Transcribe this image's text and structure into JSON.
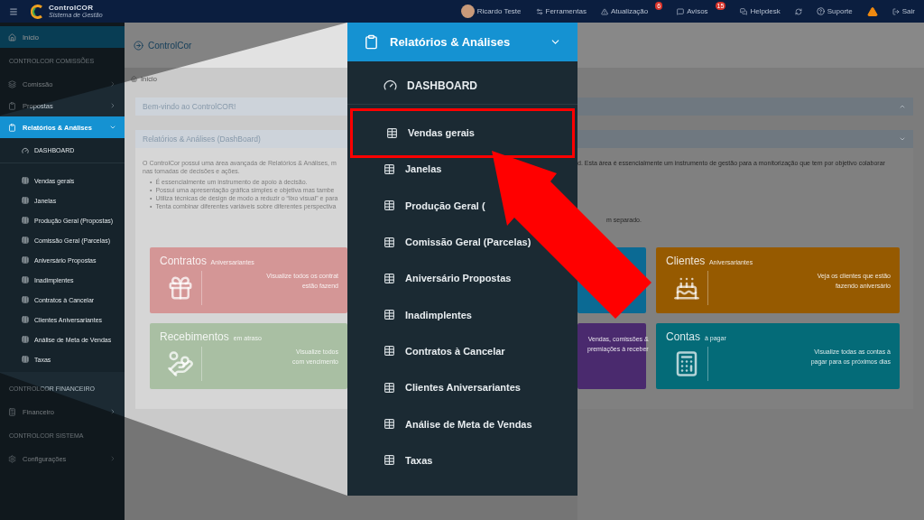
{
  "top_bar": {
    "logo_title": "ControlCOR",
    "logo_subtitle": "Sistema de Gestão",
    "actions": [
      {
        "kind": "user",
        "label": "Ricardo Teste"
      },
      {
        "kind": "link",
        "label": "Ferramentas"
      },
      {
        "kind": "link",
        "label": "Atualização",
        "badge": "6"
      },
      {
        "kind": "link",
        "label": "Avisos",
        "badge": "15"
      },
      {
        "kind": "link",
        "label": "Helpdesk"
      },
      {
        "kind": "icon"
      },
      {
        "kind": "link",
        "label": "Suporte"
      },
      {
        "kind": "icon"
      },
      {
        "kind": "link",
        "label": "Sair"
      }
    ]
  },
  "sidebar": {
    "items": [
      {
        "kind": "link",
        "label": "Início",
        "selected": true
      },
      {
        "kind": "section",
        "label": "CONTROLCOR COMISSÕES"
      },
      {
        "kind": "link",
        "label": "Comissão",
        "selected": false,
        "expanded": false
      },
      {
        "kind": "link",
        "label": "Propostas",
        "selected": false,
        "expanded": false
      },
      {
        "kind": "link",
        "label": "Relatórios & Análises",
        "selected": false,
        "expanded": true,
        "children": [
          {
            "kind": "dashboard",
            "label": "DASHBOARD"
          },
          {
            "kind": "report",
            "label": "Vendas gerais"
          },
          {
            "kind": "report",
            "label": "Janelas"
          },
          {
            "kind": "report",
            "label": "Produção Geral (Propostas)"
          },
          {
            "kind": "report",
            "label": "Comissão Geral (Parcelas)"
          },
          {
            "kind": "report",
            "label": "Aniversário Propostas"
          },
          {
            "kind": "report",
            "label": "Inadimplentes"
          },
          {
            "kind": "report",
            "label": "Contratos à Cancelar"
          },
          {
            "kind": "report",
            "label": "Clientes Aniversariantes"
          },
          {
            "kind": "report",
            "label": "Análise de Meta de Vendas"
          },
          {
            "kind": "report",
            "label": "Taxas"
          }
        ]
      },
      {
        "kind": "section",
        "label": "CONTROLCOR FINANCEIRO"
      },
      {
        "kind": "link",
        "label": "Financeiro",
        "selected": false,
        "expanded": false
      },
      {
        "kind": "section",
        "label": "CONTROLCOR SISTEMA"
      },
      {
        "kind": "link",
        "label": "Configurações",
        "selected": false,
        "expanded": false
      }
    ]
  },
  "page": {
    "title": "ControlCor",
    "breadcrumb": "Início",
    "welcome_panel": {
      "title": "Bem-vindo ao ControlCOR!",
      "collapsed": true
    },
    "dashboard_panel": {
      "title": "Relatórios & Análises (DashBoard)",
      "collapsed": false,
      "intro_left": [
        "O ControlCor possui uma área avançada de Relatórios & Análises, m",
        "nas tomadas de decisões e ações."
      ],
      "bullet_marker": "•",
      "bullets_left": [
        "É essencialmente um instrumento de apoio à decisão.",
        "Possui uma apresentação gráfica simples e objetiva mas tambe",
        "Utiliza técnicas de design de modo a reduzir o “lixo visual” e para",
        "Tenta combinar diferentes variáveis sobre diferentes perspectiva"
      ],
      "intro_right": "d. Esta área é essencialmente um instrumento de gestão para a monitorização que tem por objetivo colaborar",
      "bullet_right": "m separado."
    },
    "cards_left": [
      {
        "title": "Contratos",
        "subtitle": "Aniversariantes",
        "lines": [
          "Visualize todos os contrat",
          "estão fazend"
        ],
        "color": "#d49696"
      },
      {
        "title": "Recebimentos",
        "subtitle": "em atraso",
        "lines": [
          "Visualize todos",
          "com vencimento"
        ],
        "color": "#a9bfa3"
      }
    ],
    "cards_right": [
      {
        "color": "#0b6a94"
      },
      {
        "title": "Clientes",
        "subtitle": "Aniversariantes",
        "lines": [
          "Veja os clientes que estão",
          "fazendo aniversário"
        ],
        "color": "#965a00"
      },
      {
        "color": "#4a2a6e",
        "lines": [
          "Vendas, comissões &",
          "premiações à receber"
        ]
      },
      {
        "title": "Contas",
        "subtitle": "à pagar",
        "lines": [
          "Visualize todas as contas à",
          "pagar para os próximos dias"
        ],
        "color": "#046b78"
      }
    ]
  },
  "callout": {
    "title": "Relatórios & Análises",
    "items": [
      {
        "kind": "dashboard",
        "label": "DASHBOARD",
        "highlighted": false
      },
      {
        "kind": "report",
        "label": "Vendas gerais",
        "highlighted": true
      },
      {
        "kind": "report",
        "label": "Janelas",
        "highlighted": false
      },
      {
        "kind": "report",
        "label": "Produção Geral (",
        "highlighted": false
      },
      {
        "kind": "report",
        "label": "Comissão Geral (Parcelas)",
        "highlighted": false
      },
      {
        "kind": "report",
        "label": "Aniversário Propostas",
        "highlighted": false
      },
      {
        "kind": "report",
        "label": "Inadimplentes",
        "highlighted": false
      },
      {
        "kind": "report",
        "label": "Contratos à Cancelar",
        "highlighted": false
      },
      {
        "kind": "report",
        "label": "Clientes Aniversariantes",
        "highlighted": false
      },
      {
        "kind": "report",
        "label": "Análise de Meta de Vendas",
        "highlighted": false
      },
      {
        "kind": "report",
        "label": "Taxas",
        "highlighted": false
      }
    ]
  }
}
